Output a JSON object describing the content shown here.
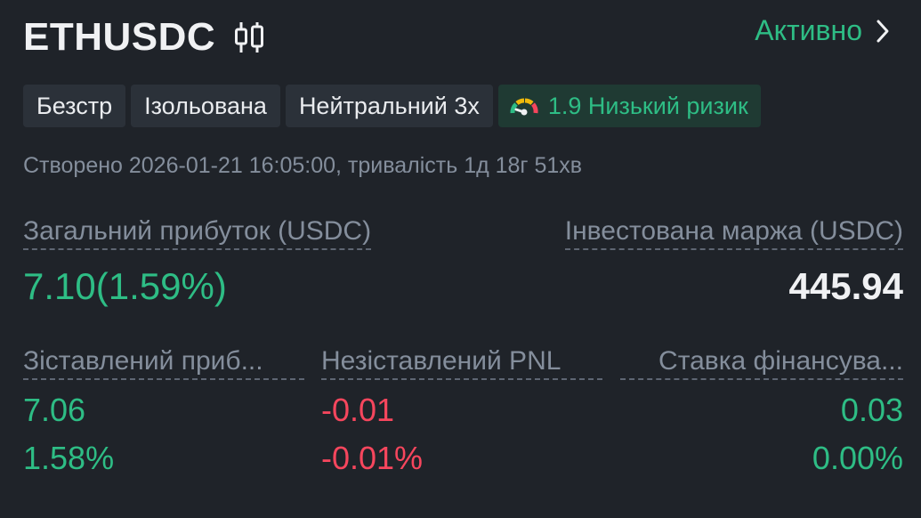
{
  "header": {
    "symbol": "ETHUSDC",
    "status_label": "Активно"
  },
  "tags": [
    {
      "label": "Безстр"
    },
    {
      "label": "Ізольована"
    },
    {
      "label": "Нейтральний 3x"
    },
    {
      "label": "1.9 Низький ризик"
    }
  ],
  "created_text": "Створено 2026-01-21 16:05:00, тривалість 1д 18г 51хв",
  "summary": {
    "total_profit_label": "Загальний прибуток (USDC)",
    "total_profit_value": "7.10(1.59%)",
    "invested_margin_label": "Інвестована маржа (USDC)",
    "invested_margin_value": "445.94"
  },
  "metrics": [
    {
      "label": "Зіставлений приб...",
      "value": "7.06",
      "percent": "1.58%"
    },
    {
      "label": "Незіставлений PNL",
      "value": "-0.01",
      "percent": "-0.01%"
    },
    {
      "label": "Ставка фінансува...",
      "value": "0.03",
      "percent": "0.00%"
    }
  ],
  "colors": {
    "background": "#1f2329",
    "positive": "#2ebd85",
    "negative": "#f6465d",
    "muted": "#848e9c"
  },
  "icons": {
    "candles": "candlestick-icon",
    "chevron": "chevron-right-icon",
    "gauge": "risk-gauge-icon"
  }
}
